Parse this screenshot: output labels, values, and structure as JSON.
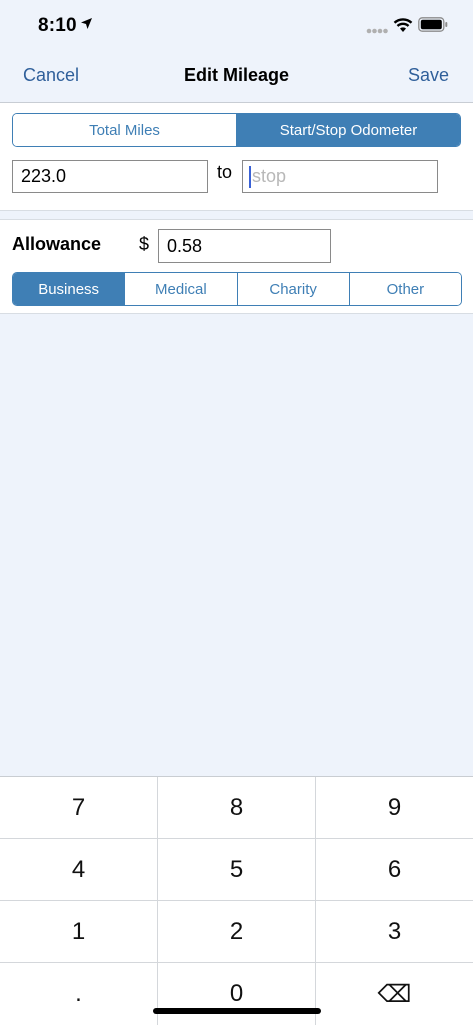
{
  "status": {
    "time": "8:10"
  },
  "nav": {
    "cancel": "Cancel",
    "title": "Edit Mileage",
    "save": "Save"
  },
  "mode_tabs": [
    {
      "label": "Total Miles",
      "active": false
    },
    {
      "label": "Start/Stop Odometer",
      "active": true
    }
  ],
  "odometer": {
    "start_value": "223.0",
    "to_label": "to",
    "stop_placeholder": "stop"
  },
  "allowance": {
    "label": "Allowance",
    "currency": "$",
    "value": "0.58"
  },
  "category_tabs": [
    {
      "label": "Business",
      "active": true
    },
    {
      "label": "Medical",
      "active": false
    },
    {
      "label": "Charity",
      "active": false
    },
    {
      "label": "Other",
      "active": false
    }
  ],
  "keypad": {
    "rows": [
      [
        "7",
        "8",
        "9"
      ],
      [
        "4",
        "5",
        "6"
      ],
      [
        "1",
        "2",
        "3"
      ],
      [
        ".",
        "0",
        "⌫"
      ]
    ]
  },
  "colors": {
    "accent": "#3f7fb5",
    "nav_link": "#2f5f9a",
    "background": "#eef3fb"
  }
}
